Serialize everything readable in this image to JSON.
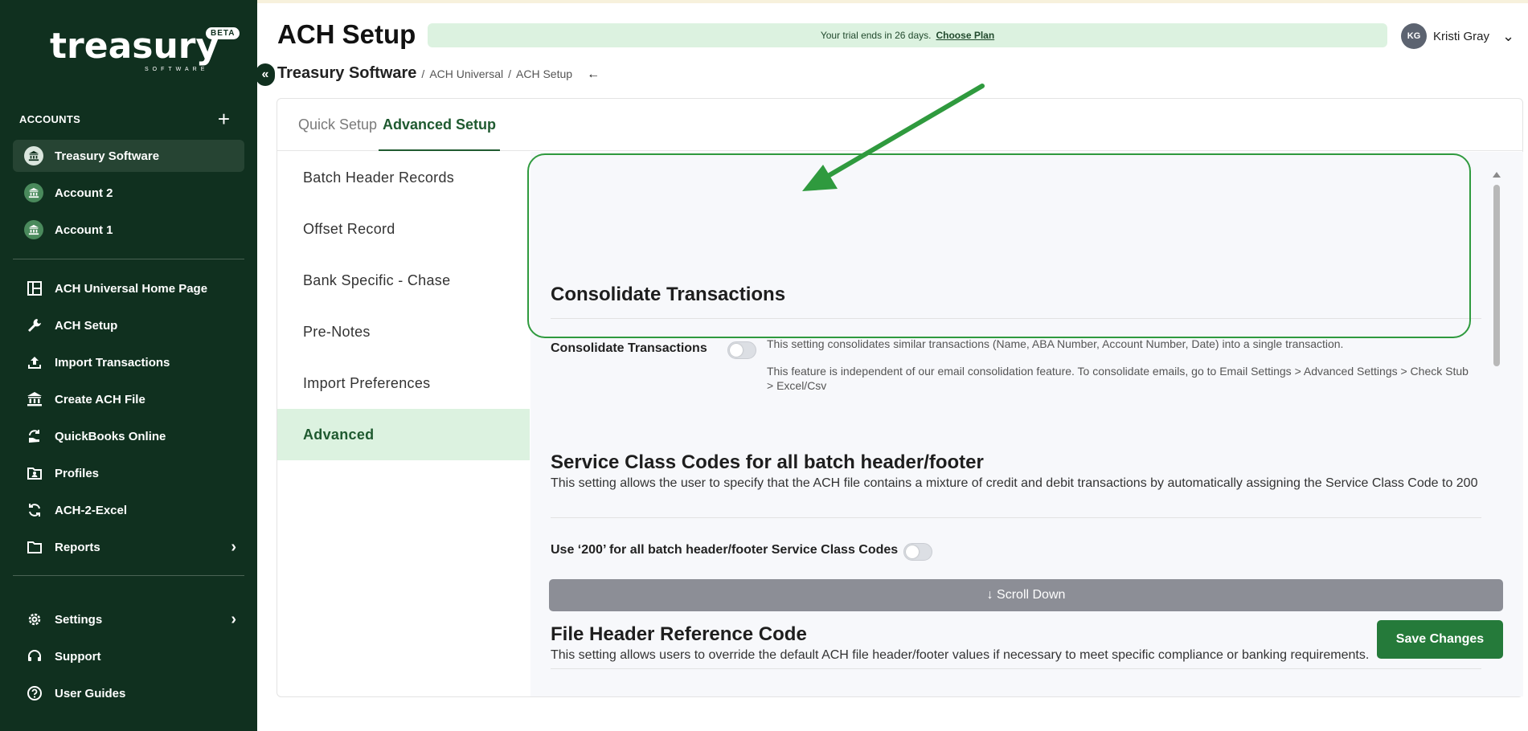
{
  "brand": {
    "logo_text": "treasury",
    "logo_sub": "SOFTWARE",
    "beta_badge": "BETA"
  },
  "sidebar": {
    "accounts_label": "ACCOUNTS",
    "add_label": "+",
    "accounts": [
      {
        "label": "Treasury Software"
      },
      {
        "label": "Account 2"
      },
      {
        "label": "Account 1"
      }
    ],
    "nav": [
      {
        "label": "ACH Universal Home Page",
        "icon": "layout-icon"
      },
      {
        "label": "ACH Setup",
        "icon": "wrench-icon"
      },
      {
        "label": "Import Transactions",
        "icon": "upload-icon"
      },
      {
        "label": "Create ACH File",
        "icon": "bank-icon"
      },
      {
        "label": "QuickBooks Online",
        "icon": "sync-hand-icon"
      },
      {
        "label": "Profiles",
        "icon": "folder-user-icon"
      },
      {
        "label": "ACH-2-Excel",
        "icon": "refresh-icon"
      },
      {
        "label": "Reports",
        "icon": "folder-icon"
      }
    ],
    "bottom_nav": [
      {
        "label": "Settings",
        "icon": "gear-icon"
      },
      {
        "label": "Support",
        "icon": "headset-icon"
      },
      {
        "label": "User Guides",
        "icon": "help-icon"
      }
    ]
  },
  "header": {
    "title": "ACH Setup",
    "trial_text": "Your trial ends in 26 days.",
    "trial_link": "Choose Plan",
    "user_initials": "KG",
    "user_name": "Kristi Gray"
  },
  "breadcrumb": {
    "root": "Treasury Software",
    "items": [
      "ACH Universal",
      "ACH Setup"
    ],
    "separator": "/"
  },
  "tabs": [
    {
      "label": "Quick Setup",
      "active": false
    },
    {
      "label": "Advanced Setup",
      "active": true
    }
  ],
  "subnav": [
    {
      "label": "Batch Header Records"
    },
    {
      "label": "Offset Record"
    },
    {
      "label": "Bank Specific - Chase"
    },
    {
      "label": "Pre-Notes"
    },
    {
      "label": "Import Preferences"
    },
    {
      "label": "Advanced",
      "active": true
    }
  ],
  "sections": {
    "consolidate": {
      "title": "Consolidate Transactions",
      "label": "Consolidate Transactions",
      "enabled": false,
      "note1": "This setting consolidates similar transactions (Name, ABA Number, Account Number, Date) into a single transaction.",
      "note2": "This feature is independent of our email consolidation feature. To consolidate emails, go to Email Settings > Advanced Settings > Check Stub > Excel/Csv"
    },
    "service_class": {
      "title": "Service Class Codes for all batch header/footer",
      "desc": "This setting allows the user to specify that the ACH file contains a mixture of credit and debit transactions by automatically assigning the Service Class Code to 200",
      "label": "Use ‘200’ for all batch header/footer Service Class Codes",
      "enabled": false
    },
    "file_header": {
      "title": "File Header Reference Code",
      "desc": "This setting allows users to override the default ACH file header/footer values if necessary to meet specific compliance or banking requirements."
    }
  },
  "actions": {
    "scroll_down": "↓ Scroll Down",
    "save": "Save Changes"
  },
  "colors": {
    "sidebar_bg": "#10301f",
    "accent": "#257a3a",
    "highlight_border": "#2f9a3e",
    "trial_bg": "#dcf2e0"
  }
}
